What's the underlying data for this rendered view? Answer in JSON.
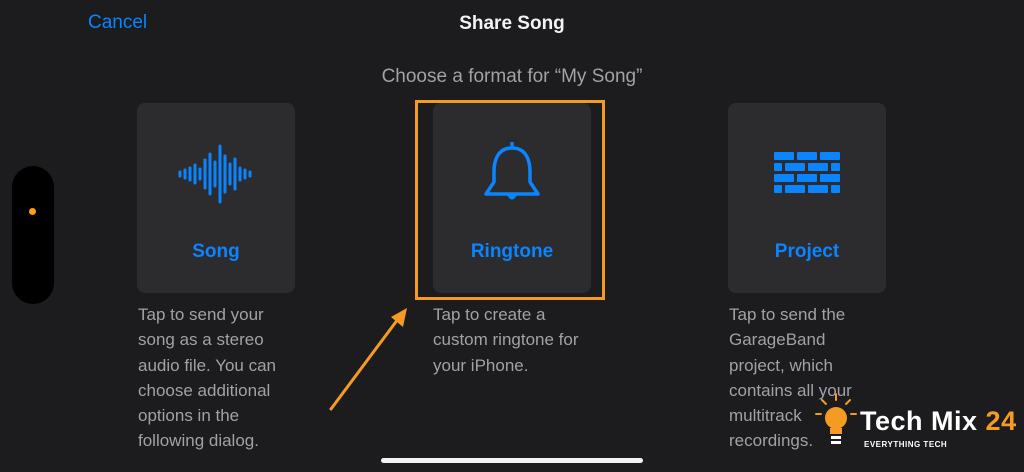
{
  "header": {
    "cancel_label": "Cancel",
    "title": "Share Song",
    "subtitle": "Choose a format for “My Song”"
  },
  "options": [
    {
      "label": "Song",
      "icon": "waveform-icon",
      "description": [
        "Tap to send your",
        "song as a stereo",
        "audio file. You can",
        "choose additional",
        "options in the",
        "following dialog."
      ]
    },
    {
      "label": "Ringtone",
      "icon": "bell-icon",
      "description": [
        "Tap to create a",
        "custom ringtone for",
        "your iPhone."
      ],
      "highlighted": true
    },
    {
      "label": "Project",
      "icon": "bricks-icon",
      "description": [
        "Tap to send the",
        "GarageBand",
        "project, which",
        "contains all your",
        "multitrack",
        "recordings."
      ]
    }
  ],
  "watermark": {
    "name": "Tech Mix",
    "number": "24",
    "tagline": "EVERYTHING TECH"
  },
  "colors": {
    "background": "#1c1c1e",
    "card": "#2c2c2e",
    "accent_blue": "#0a84ff",
    "annotation_orange": "#f59a23",
    "secondary_text": "#a1a1a6"
  }
}
